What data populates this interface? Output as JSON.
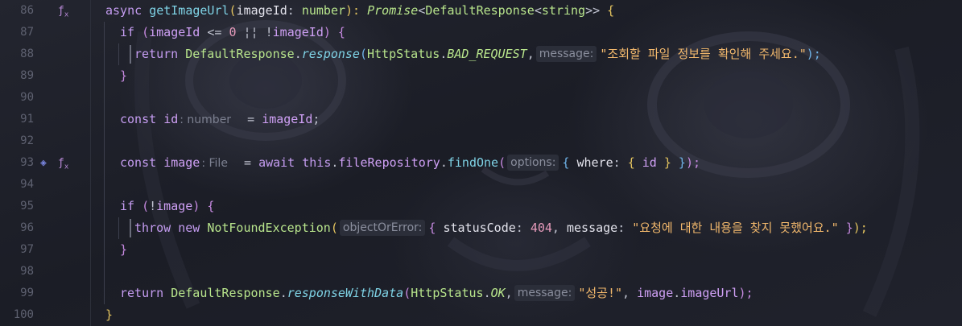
{
  "gutter": {
    "line_numbers": [
      "86",
      "87",
      "88",
      "89",
      "90",
      "91",
      "92",
      "93",
      "94",
      "95",
      "96",
      "97",
      "98",
      "99",
      "100"
    ],
    "icons": {
      "86": "function-marker-icon",
      "93": "database-icon"
    }
  },
  "code": {
    "l86": {
      "t1": "async",
      "t2": "getImageUrl",
      "t3": "(",
      "t4": "imageId",
      "t5": ": ",
      "t6": "number",
      "t7": "): ",
      "t8": "Promise",
      "t9": "<",
      "t10": "DefaultResponse",
      "t11": "<",
      "t12": "string",
      "t13": ">>",
      "t14": " {"
    },
    "l87": {
      "t1": "if",
      "t2": " (",
      "t3": "imageId",
      "t4": " <= ",
      "t5": "0",
      "t6": " ¦¦ ",
      "t7": "!",
      "t8": "imageId",
      "t9": ") {"
    },
    "l88": {
      "t1": "return",
      "t2": "DefaultResponse",
      "t3": ".",
      "t4": "response",
      "t5": "(",
      "t6": "HttpStatus",
      "t7": ".",
      "t8": "BAD_REQUEST",
      "t9": ",",
      "hint": "message:",
      "t10": "\"조회할 파일 정보를 확인해 주세요.\"",
      "t11": ");"
    },
    "l89": {
      "t1": "}"
    },
    "l91": {
      "t1": "const",
      "t2": "id",
      "type_hint": ": number",
      "t3": "=",
      "t4": "imageId",
      "t5": ";"
    },
    "l93": {
      "t1": "const",
      "t2": "image",
      "type_hint": ": File",
      "t3": "=",
      "t4": "await",
      "t5": "this",
      "t6": ".",
      "t7": "fileRepository",
      "t8": ".",
      "t9": "findOne",
      "t10": "(",
      "hint": "options:",
      "t11": "{",
      "t12": "where",
      "t13": ":",
      "t14": "{",
      "t15": "id",
      "t16": "}",
      "t17": "}",
      "t18": ");"
    },
    "l95": {
      "t1": "if",
      "t2": " (",
      "t3": "!",
      "t4": "image",
      "t5": ") {"
    },
    "l96": {
      "t1": "throw",
      "t2": "new",
      "t3": "NotFoundException",
      "t4": "(",
      "hint": "objectOrError:",
      "t5": "{",
      "t6": "statusCode",
      "t7": ":",
      "t8": "404",
      "t9": ",",
      "t10": "message",
      "t11": ":",
      "t12": "\"요청에 대한 내용을 찾지 못했어요.\"",
      "t13": "}",
      "t14": ");"
    },
    "l97": {
      "t1": "}"
    },
    "l99": {
      "t1": "return",
      "t2": "DefaultResponse",
      "t3": ".",
      "t4": "responseWithData",
      "t5": "(",
      "t6": "HttpStatus",
      "t7": ".",
      "t8": "OK",
      "t9": ",",
      "hint": "message:",
      "t10": "\"성공!\"",
      "t11": ",",
      "t12": "image",
      "t13": ".",
      "t14": "imageUrl",
      "t15": ");"
    },
    "l100": {
      "t1": "}"
    }
  },
  "colors": {
    "keyword": "#c49cf0",
    "function": "#7fd3e6",
    "type": "#b8e58c",
    "string": "#f2b86c",
    "number": "#e79bbb",
    "background": "#1b1d26"
  }
}
